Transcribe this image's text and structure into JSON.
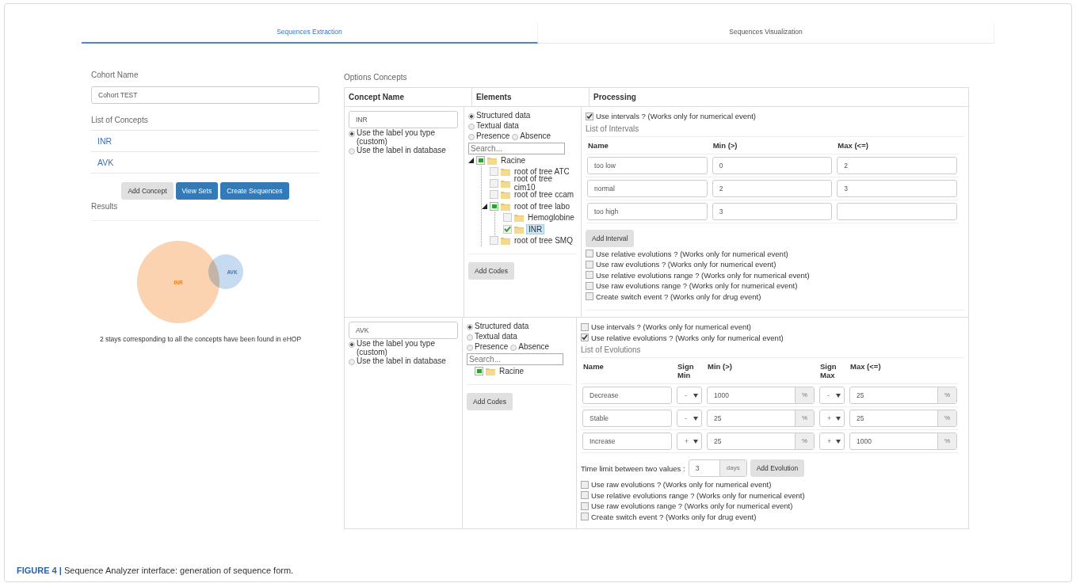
{
  "tabs": [
    {
      "label": "Sequences Extraction",
      "selected": true
    },
    {
      "label": "Sequences Visualization",
      "selected": false
    }
  ],
  "cohort": {
    "label": "Cohort Name",
    "value": "Cohort TEST"
  },
  "concepts_list": {
    "label": "List of Concepts",
    "items": [
      "INR",
      "AVK"
    ]
  },
  "buttons": [
    {
      "label": "Add Concept",
      "kind": "default"
    },
    {
      "label": "View Sets",
      "kind": "primary"
    },
    {
      "label": "Create Sequences",
      "kind": "primary"
    }
  ],
  "results": {
    "label": "Results",
    "venn": [
      {
        "label": "INR",
        "color": "#fbd3b0"
      },
      {
        "label": "AVK",
        "color": "#c6daf0"
      }
    ],
    "message": "2 stays corresponding to all the concepts have been found in eHOP"
  },
  "options": {
    "title": "Options Concepts",
    "columns": [
      "Concept Name",
      "Elements",
      "Processing"
    ],
    "rows": [
      {
        "concept": {
          "value": "INR",
          "label_options": [
            {
              "label": "Use the label you type (custom)",
              "selected": true
            },
            {
              "label": "Use the label in database",
              "selected": false
            }
          ]
        },
        "elements": {
          "source_options": [
            {
              "label": "Structured data",
              "selected": true
            },
            {
              "label": "Textual data",
              "selected": false
            }
          ],
          "presence_options": [
            {
              "label": "Presence",
              "selected": false
            },
            {
              "label": "Absence",
              "selected": false
            }
          ],
          "search_placeholder": "Search...",
          "tree": [
            {
              "label": "Racine",
              "checked": false,
              "partial": true,
              "selected": false,
              "expanded": true,
              "children": [
                {
                  "label": "root of tree ATC",
                  "checked": false,
                  "partial": false,
                  "selected": false,
                  "expanded": false
                },
                {
                  "label": "root of tree cim10",
                  "checked": false,
                  "partial": false,
                  "selected": false,
                  "expanded": false
                },
                {
                  "label": "root of tree ccam",
                  "checked": false,
                  "partial": false,
                  "selected": false,
                  "expanded": false
                },
                {
                  "label": "root of tree labo",
                  "checked": false,
                  "partial": true,
                  "selected": false,
                  "expanded": true,
                  "children": [
                    {
                      "label": "Hemoglobine",
                      "checked": false,
                      "partial": false,
                      "selected": false,
                      "expanded": false
                    },
                    {
                      "label": "INR",
                      "checked": true,
                      "partial": false,
                      "selected": true,
                      "expanded": false
                    }
                  ]
                },
                {
                  "label": "root of tree SMQ",
                  "checked": false,
                  "partial": false,
                  "selected": false,
                  "expanded": false
                }
              ]
            }
          ],
          "add_button": "Add Codes"
        },
        "processing": [
          {
            "kind": "checkbox",
            "label": "Use intervals ? (Works only for numerical event)",
            "checked": true
          },
          {
            "kind": "intervals",
            "title": "List of Intervals",
            "columns": [
              "Name",
              "Min (>)",
              "Max (<=)"
            ],
            "rows": [
              {
                "name": "too low",
                "min": "0",
                "max": "2"
              },
              {
                "name": "normal",
                "min": "2",
                "max": "3"
              },
              {
                "name": "too high",
                "min": "3"
              }
            ],
            "add_button": "Add Interval"
          },
          {
            "kind": "checkbox",
            "label": "Use relative evolutions ? (Works only for numerical event)",
            "checked": false
          },
          {
            "kind": "checkbox",
            "label": "Use raw evolutions ? (Works only for numerical event)",
            "checked": false
          },
          {
            "kind": "checkbox",
            "label": "Use relative evolutions range ? (Works only for numerical event)",
            "checked": false
          },
          {
            "kind": "checkbox",
            "label": "Use raw evolutions range ? (Works only for numerical event)",
            "checked": false
          },
          {
            "kind": "checkbox",
            "label": "Create switch event ? (Works only for drug event)",
            "checked": false
          }
        ]
      },
      {
        "concept": {
          "value": "AVK",
          "label_options": [
            {
              "label": "Use the label you type (custom)",
              "selected": true
            },
            {
              "label": "Use the label in database",
              "selected": false
            }
          ]
        },
        "elements": {
          "source_options": [
            {
              "label": "Structured data",
              "selected": true
            },
            {
              "label": "Textual data",
              "selected": false
            }
          ],
          "presence_options": [
            {
              "label": "Presence",
              "selected": false
            },
            {
              "label": "Absence",
              "selected": false
            }
          ],
          "search_placeholder": "Search...",
          "tree": [
            {
              "label": "Racine",
              "checked": false,
              "partial": true,
              "selected": false,
              "expanded": false
            }
          ],
          "add_button": "Add Codes"
        },
        "processing": [
          {
            "kind": "checkbox",
            "label": "Use intervals ? (Works only for numerical event)",
            "checked": false
          },
          {
            "kind": "checkbox",
            "label": "Use relative evolutions ? (Works only for numerical event)",
            "checked": true
          },
          {
            "kind": "evolutions",
            "title": "List of Evolutions",
            "columns": [
              "Name",
              "Sign Min",
              "Min (>)",
              "Sign Max",
              "Max (<=)"
            ],
            "rows": [
              {
                "name": "Decrease",
                "sign_min": "-",
                "min": "1000",
                "min_unit": "%",
                "sign_max": "-",
                "max": "25",
                "max_unit": "%"
              },
              {
                "name": "Stable",
                "sign_min": "-",
                "min": "25",
                "min_unit": "%",
                "sign_max": "+",
                "max": "25",
                "max_unit": "%"
              },
              {
                "name": "Increase",
                "sign_min": "+",
                "min": "25",
                "min_unit": "%",
                "sign_max": "+",
                "max": "1000",
                "max_unit": "%"
              }
            ],
            "time_limit": {
              "label": "Time limit between two values :",
              "value": "3",
              "unit": "days"
            },
            "add_button": "Add Evolution"
          },
          {
            "kind": "checkbox",
            "label": "Use raw evolutions ? (Works only for numerical event)",
            "checked": false
          },
          {
            "kind": "checkbox",
            "label": "Use relative evolutions range ? (Works only for numerical event)",
            "checked": false
          },
          {
            "kind": "checkbox",
            "label": "Use raw evolutions range ? (Works only for numerical event)",
            "checked": false
          },
          {
            "kind": "checkbox",
            "label": "Create switch event ? (Works only for drug event)",
            "checked": false
          }
        ]
      }
    ]
  },
  "caption": "**FIGURE 4 |** Sequence Analyzer interface: generation of sequence form."
}
